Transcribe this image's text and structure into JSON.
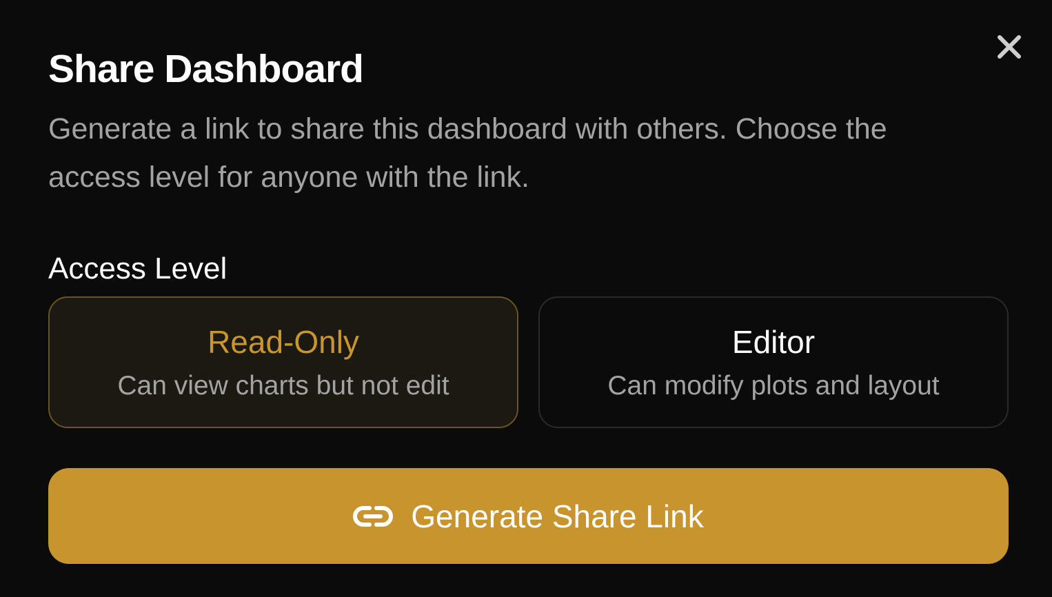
{
  "dialog": {
    "title": "Share Dashboard",
    "description": "Generate a link to share this dashboard with others. Choose the access level for anyone with the link.",
    "close_icon": "close-icon"
  },
  "access": {
    "label": "Access Level",
    "selected": "Read-Only",
    "options": [
      {
        "title": "Read-Only",
        "description": "Can view charts but not edit"
      },
      {
        "title": "Editor",
        "description": "Can modify plots and layout"
      }
    ]
  },
  "actions": {
    "generate_label": "Generate Share Link",
    "generate_icon": "link-icon"
  },
  "colors": {
    "accent": "#c8942e",
    "background": "#0b0b0b",
    "selected_bg": "#1c1812",
    "selected_border": "#6b5420",
    "muted_text": "#a3a3a3"
  }
}
